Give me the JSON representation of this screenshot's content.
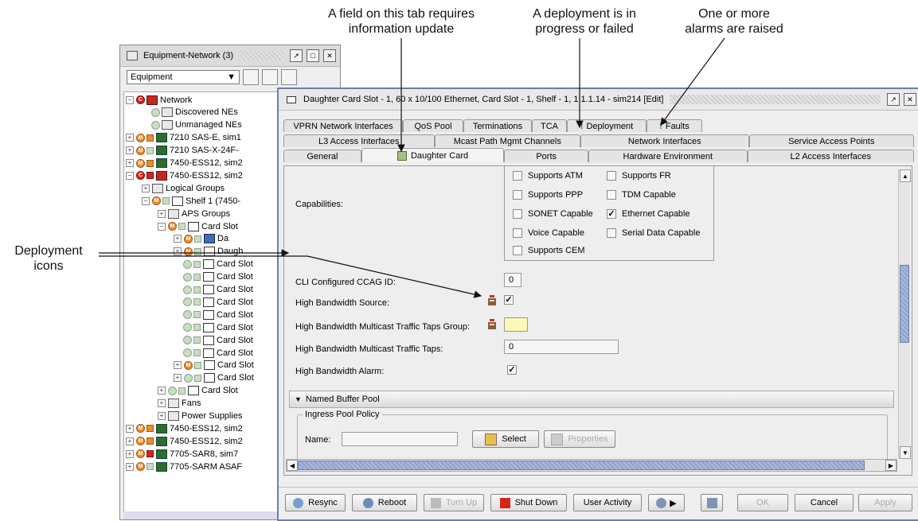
{
  "annotations": {
    "field_update": [
      "A field on this tab requires",
      "information update"
    ],
    "deployment": [
      "A deployment is in",
      "progress or failed"
    ],
    "alarms": [
      "One or more",
      "alarms are raised"
    ],
    "deployment_icons": [
      "Deployment",
      "icons"
    ]
  },
  "tree_window": {
    "title": "Equipment-Network (3)",
    "combo_value": "Equipment",
    "rows": [
      {
        "label": "Network"
      },
      {
        "label": "Discovered NEs"
      },
      {
        "label": "Unmanaged NEs"
      },
      {
        "label": "7210 SAS-E, sim1"
      },
      {
        "label": "7210 SAS-X-24F-"
      },
      {
        "label": "7450-ESS12, sim2"
      },
      {
        "label": "7450-ESS12, sim2"
      },
      {
        "label": "Logical Groups"
      },
      {
        "label": "Shelf 1 (7450-"
      },
      {
        "label": "APS Groups"
      },
      {
        "label": "Card Slot"
      },
      {
        "label": "Da"
      },
      {
        "label": "Daugh"
      },
      {
        "label": "Card Slot"
      },
      {
        "label": "Card Slot"
      },
      {
        "label": "Card Slot"
      },
      {
        "label": "Card Slot"
      },
      {
        "label": "Card Slot"
      },
      {
        "label": "Card Slot"
      },
      {
        "label": "Card Slot"
      },
      {
        "label": "Card Slot"
      },
      {
        "label": "Card Slot"
      },
      {
        "label": "Card Slot"
      },
      {
        "label": "Card Slot"
      },
      {
        "label": "Fans"
      },
      {
        "label": "Power Supplies"
      },
      {
        "label": "7450-ESS12, sim2"
      },
      {
        "label": "7450-ESS12, sim2"
      },
      {
        "label": "7705-SAR8, sim7"
      },
      {
        "label": "7705-SARM ASAF"
      }
    ]
  },
  "dialog": {
    "title": "Daughter Card Slot - 1, 60 x 10/100 Ethernet, Card Slot - 1, Shelf - 1, 1.1.1.14 - sim214 [Edit]",
    "tabs_row1": [
      "VPRN Network Interfaces",
      "QoS Pool",
      "Terminations",
      "TCA",
      "Deployment",
      "Faults"
    ],
    "tabs_row2": [
      "L3 Access Interfaces",
      "Mcast Path Mgmt Channels",
      "Network Interfaces",
      "Service Access Points"
    ],
    "tabs_row3": [
      "General",
      "Daughter Card",
      "Ports",
      "Hardware Environment",
      "L2 Access Interfaces"
    ],
    "capabilities_label": "Capabilities:",
    "capabilities": {
      "atm": "Supports ATM",
      "fr": "Supports FR",
      "ppp": "Supports PPP",
      "tdm": "TDM Capable",
      "sonet": "SONET Capable",
      "ethernet": "Ethernet Capable",
      "voice": "Voice Capable",
      "serial": "Serial Data Capable",
      "cem": "Supports CEM"
    },
    "fields": {
      "ccag_label": "CLI Configured CCAG ID:",
      "ccag_value": "0",
      "hb_source_label": "High Bandwidth Source:",
      "hb_mcast_group_label": "High Bandwidth Multicast Traffic Taps Group:",
      "hb_mcast_taps_label": "High Bandwidth Multicast Traffic Taps:",
      "hb_mcast_taps_value": "0",
      "hb_alarm_label": "High Bandwidth Alarm:"
    },
    "named_buffer_pool": "Named Buffer Pool",
    "ingress_pool_policy": "Ingress Pool Policy",
    "name_label": "Name:",
    "select_label": "Select",
    "properties_label": "Properties",
    "footer": {
      "resync": "Resync",
      "reboot": "Reboot",
      "turn_up": "Turn Up",
      "shut_down": "Shut Down",
      "user_activity": "User Activity",
      "ok": "OK",
      "cancel": "Cancel",
      "apply": "Apply"
    }
  }
}
